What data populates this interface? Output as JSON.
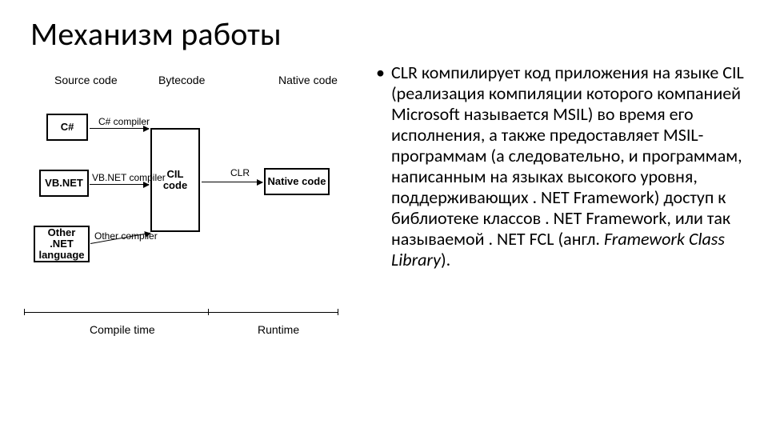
{
  "title": "Механизм работы",
  "bullet": {
    "text_before_italics": "CLR компилирует код приложения на языке CIL (реализация компиляции которого компанией Microsoft называется MSIL) во время его исполнения, а также предоставляет MSIL-программам (а следовательно, и программам, написанным на языках высокого уровня, поддерживающих . NET Framework) доступ к библиотеке классов . NET Framework, или так называемой . NET FCL (англ. ",
    "text_italic": "Framework Class Library",
    "text_after_italics": ")."
  },
  "chart_data": {
    "type": "diagram",
    "title": "",
    "columns": [
      {
        "id": "source",
        "label": "Source code"
      },
      {
        "id": "byte",
        "label": "Bytecode"
      },
      {
        "id": "native",
        "label": "Native code"
      }
    ],
    "nodes": [
      {
        "id": "csharp",
        "label": "C#",
        "column": "source"
      },
      {
        "id": "vbnet",
        "label": "VB.NET",
        "column": "source"
      },
      {
        "id": "other",
        "label": "Other .NET language",
        "column": "source"
      },
      {
        "id": "cil",
        "label": "CIL code",
        "column": "byte"
      },
      {
        "id": "native",
        "label": "Native code",
        "column": "native"
      }
    ],
    "edges": [
      {
        "from": "csharp",
        "to": "cil",
        "label": "C# compiler"
      },
      {
        "from": "vbnet",
        "to": "cil",
        "label": "VB.NET compiler"
      },
      {
        "from": "other",
        "to": "cil",
        "label": "Other compiler"
      },
      {
        "from": "cil",
        "to": "native",
        "label": "CLR"
      }
    ],
    "phases": [
      {
        "id": "compile",
        "label": "Compile time",
        "spans": [
          "source",
          "byte"
        ]
      },
      {
        "id": "runtime",
        "label": "Runtime",
        "spans": [
          "byte",
          "native"
        ]
      }
    ]
  }
}
